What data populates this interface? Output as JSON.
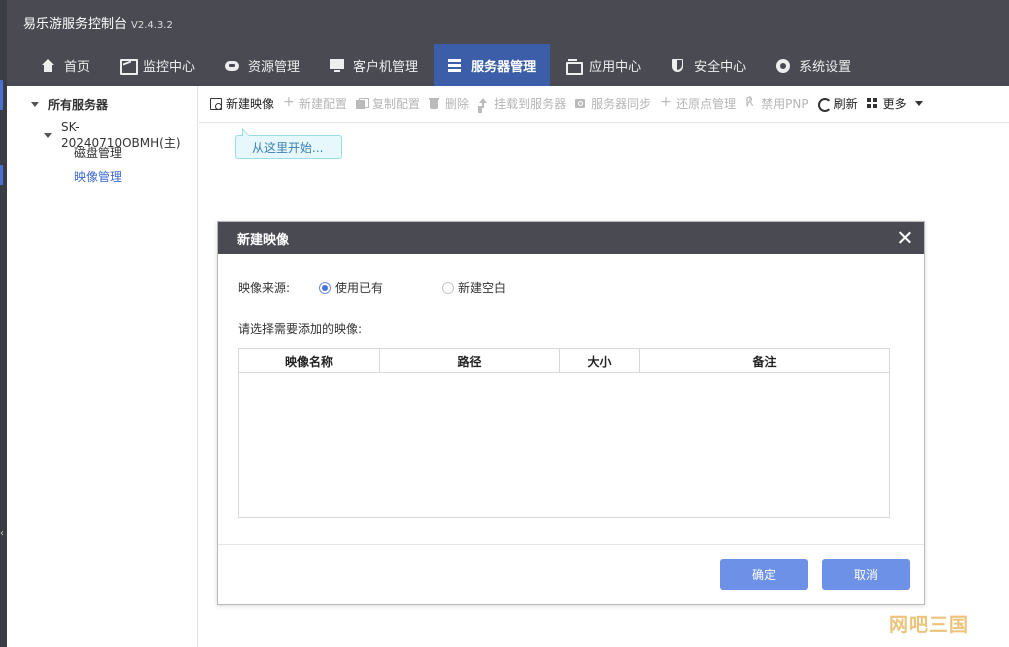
{
  "app": {
    "title": "易乐游服务控制台",
    "version": "V2.4.3.2"
  },
  "nav": [
    {
      "label": "首页",
      "icon": "home-icon"
    },
    {
      "label": "监控中心",
      "icon": "monitor-icon"
    },
    {
      "label": "资源管理",
      "icon": "resource-icon"
    },
    {
      "label": "客户机管理",
      "icon": "client-icon"
    },
    {
      "label": "服务器管理",
      "icon": "server-icon",
      "active": true
    },
    {
      "label": "应用中心",
      "icon": "app-icon"
    },
    {
      "label": "安全中心",
      "icon": "shield-icon"
    },
    {
      "label": "系统设置",
      "icon": "gear-icon"
    }
  ],
  "tree": {
    "root": "所有服务器",
    "server": "SK-20240710OBMH(主)",
    "children": [
      "磁盘管理",
      "映像管理"
    ],
    "selected": "映像管理"
  },
  "toolbar": {
    "new_image": "新建映像",
    "new_config": "新建配置",
    "copy_config": "复制配置",
    "delete": "删除",
    "mount": "挂载到服务器",
    "sync": "服务器同步",
    "restore": "还原点管理",
    "disable_pnp": "禁用PNP",
    "refresh": "刷新",
    "more": "更多"
  },
  "tooltip": "从这里开始...",
  "dialog": {
    "title": "新建映像",
    "source_label": "映像来源:",
    "source_options": [
      "使用已有",
      "新建空白"
    ],
    "source_selected": "使用已有",
    "choose_label": "请选择需要添加的映像:",
    "table": {
      "columns": [
        "映像名称",
        "路径",
        "大小",
        "备注"
      ],
      "rows": []
    },
    "ok": "确定",
    "cancel": "取消"
  },
  "watermark": "网吧三国",
  "colors": {
    "header": "#4a4a53",
    "active_tab": "#3c5ea8",
    "button": "#6e91e8",
    "selected_text": "#3c6ad2"
  }
}
